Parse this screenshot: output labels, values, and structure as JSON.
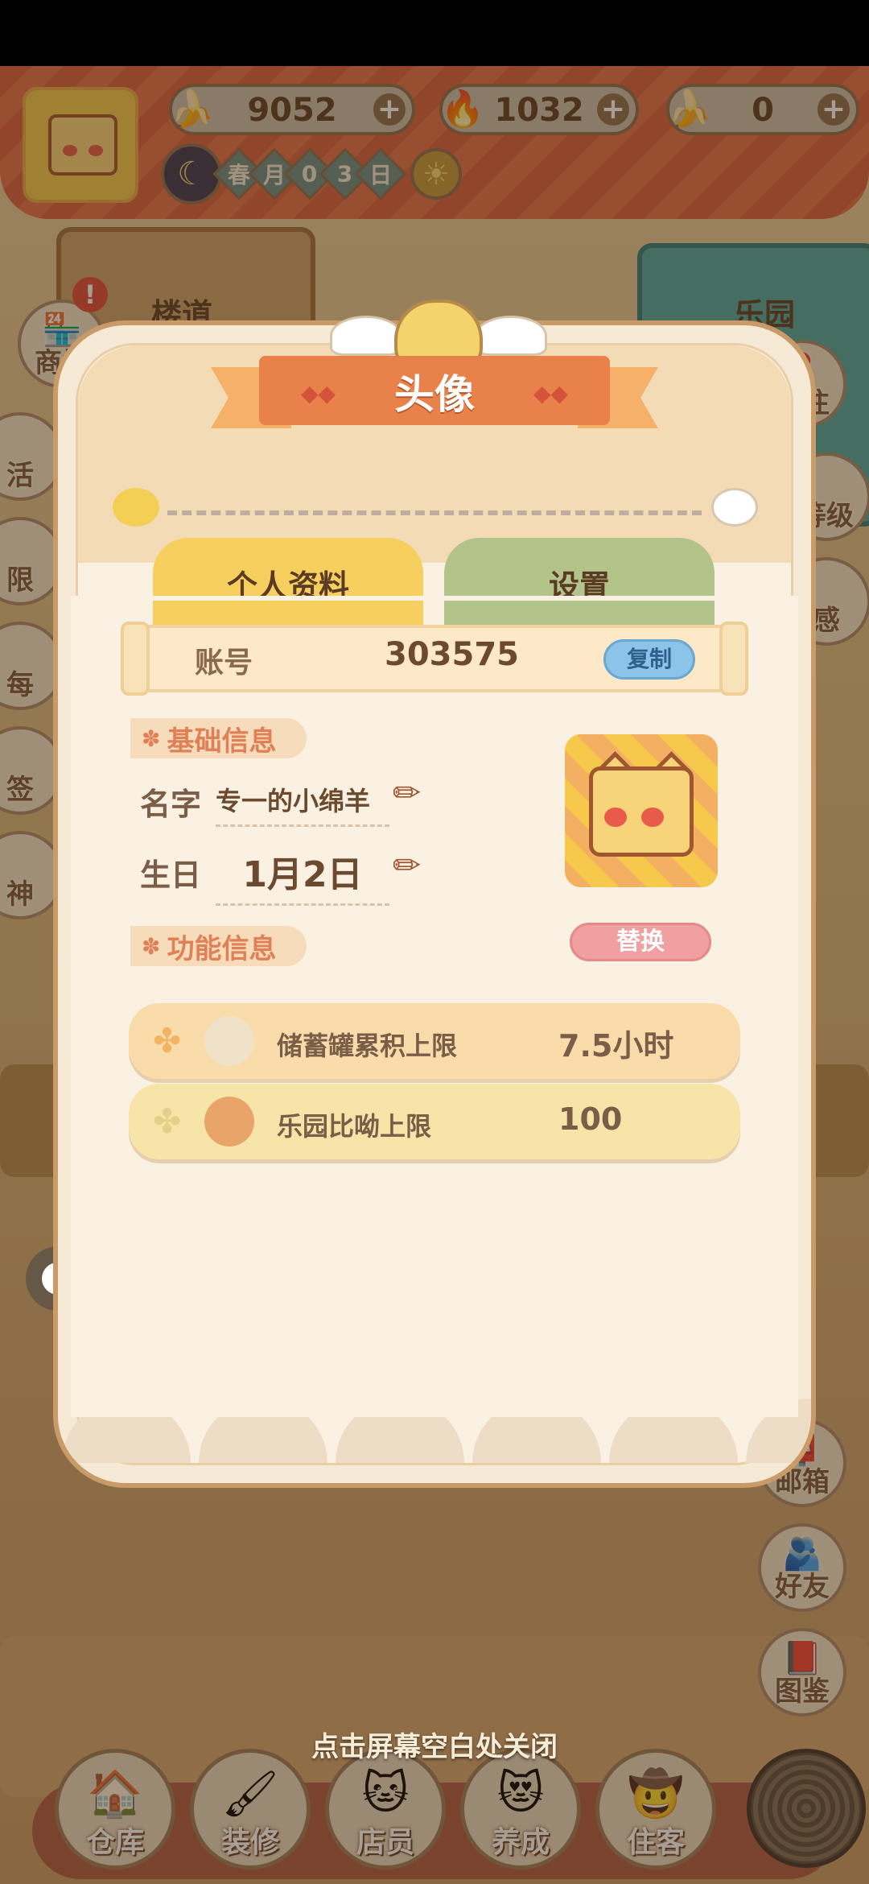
{
  "hud": {
    "resources": [
      {
        "icon": "banana-icon",
        "value": "9052"
      },
      {
        "icon": "blue-flame-icon",
        "value": "1032"
      },
      {
        "icon": "blue-banana-icon",
        "value": "0"
      }
    ],
    "season_chars": [
      "春",
      "月",
      "0",
      "3",
      "日"
    ]
  },
  "scene": {
    "signs": [
      "楼道",
      "乐园"
    ],
    "left_buttons": [
      "商城",
      "活",
      "限",
      "每",
      "签",
      "神"
    ],
    "right_buttons": [
      "前往",
      "等级",
      "感",
      "邮箱",
      "好友",
      "图鉴"
    ]
  },
  "modal": {
    "title": "头像",
    "tabs": [
      "个人资料",
      "设置"
    ],
    "account": {
      "label": "账号",
      "id": "303575",
      "copy": "复制"
    },
    "basic_section": "基础信息",
    "name_label": "名字",
    "name_value": "专一的小绵羊",
    "birthday_label": "生日",
    "birthday_value": "1月2日",
    "replace": "替换",
    "func_section": "功能信息",
    "perks": [
      {
        "name": "储蓄罐累积上限",
        "value": "7.5小时"
      },
      {
        "name": "乐园比呦上限",
        "value": "100"
      }
    ]
  },
  "close_hint": "点击屏幕空白处关闭",
  "bottom_nav": [
    "仓库",
    "装修",
    "店员",
    "养成",
    "住客"
  ],
  "colors": {
    "title_ribbon": "#e9814b",
    "tab_active": "#f6cf5f",
    "tab_inactive": "#b2c48a",
    "copy_button": "#8cc3e8",
    "replace_button": "#f0a0a0",
    "perk_bar_1": "#f9dcaa",
    "perk_bar_2": "#f6e4a8"
  }
}
